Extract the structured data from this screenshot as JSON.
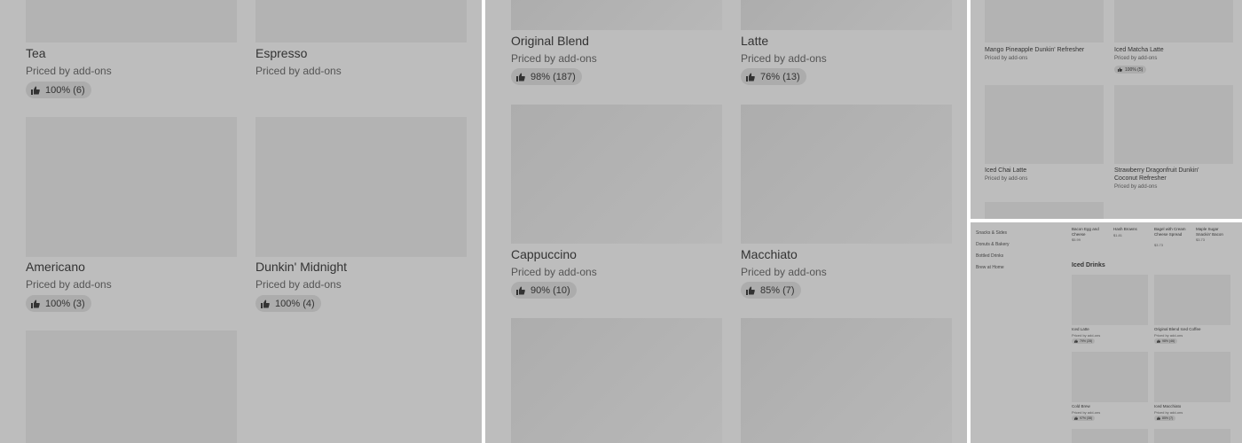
{
  "panel1": {
    "items": [
      {
        "name": "Tea",
        "price": "Priced by add-ons",
        "rating": "100% (6)"
      },
      {
        "name": "Espresso",
        "price": "Priced by add-ons",
        "rating": ""
      },
      {
        "name": "Americano",
        "price": "Priced by add-ons",
        "rating": "100% (3)"
      },
      {
        "name": "Dunkin' Midnight",
        "price": "Priced by add-ons",
        "rating": "100% (4)"
      }
    ]
  },
  "panel2": {
    "items": [
      {
        "name": "Original Blend",
        "price": "Priced by add-ons",
        "rating": "98% (187)"
      },
      {
        "name": "Latte",
        "price": "Priced by add-ons",
        "rating": "76% (13)"
      },
      {
        "name": "Cappuccino",
        "price": "Priced by add-ons",
        "rating": "90% (10)"
      },
      {
        "name": "Macchiato",
        "price": "Priced by add-ons",
        "rating": "85% (7)"
      }
    ]
  },
  "panel3": {
    "items": [
      {
        "name": "Mango Pineapple Dunkin' Refresher",
        "price": "Priced by add-ons",
        "rating": ""
      },
      {
        "name": "Iced Matcha Latte",
        "price": "Priced by add-ons",
        "rating": "100% (5)"
      },
      {
        "name": "Iced Chai Latte",
        "price": "Priced by add-ons",
        "rating": ""
      },
      {
        "name": "Strawberry Dragonfruit Dunkin' Coconut Refresher",
        "price": "Priced by add-ons",
        "rating": ""
      }
    ]
  },
  "panel4": {
    "nav": [
      "Snacks & Sides",
      "Donuts & Bakery",
      "Bottled Drinks",
      "Brew at Home"
    ],
    "top_items": [
      {
        "name": "Bacon Egg and Cheese",
        "price": "$5.99"
      },
      {
        "name": "Hash Browns",
        "price": "$1.81"
      },
      {
        "name": "Bagel with Cream Cheese Spread",
        "price": "$3.73"
      },
      {
        "name": "Maple Sugar Snackin' Bacon",
        "price": "$3.73"
      }
    ],
    "section_title": "Iced Drinks",
    "items": [
      {
        "name": "Iced Latte",
        "price": "Priced by add-ons",
        "rating": "79% (28)"
      },
      {
        "name": "Original Blend Iced Coffee",
        "price": "Priced by add-ons",
        "rating": "98% (46)"
      },
      {
        "name": "Cold Brew",
        "price": "Priced by add-ons",
        "rating": "97% (38)"
      },
      {
        "name": "Iced Macchiato",
        "price": "Priced by add-ons",
        "rating": "85% (7)"
      }
    ]
  },
  "icons": {
    "rating": "thumbs-up-icon"
  },
  "colors": {
    "panel_bg": "#bdbdbd",
    "image_placeholder": "#b3b3b3",
    "rating_pill": "#acacac"
  }
}
